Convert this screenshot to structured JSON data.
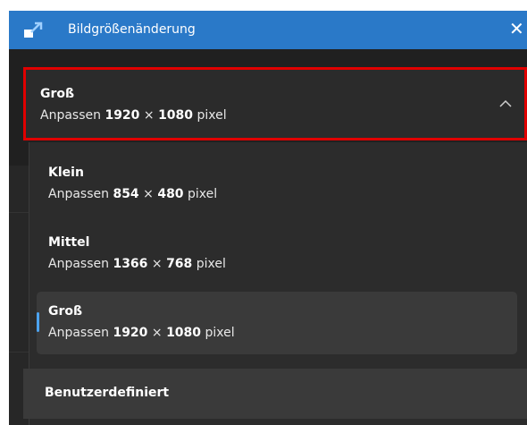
{
  "window": {
    "title": "Bildgrößenänderung",
    "close_glyph": "✕",
    "app_icon": "resize-app-icon",
    "accent_color": "#2a79c8"
  },
  "combo": {
    "label": "Groß",
    "prefix": "Anpassen",
    "width": "1920",
    "times": "×",
    "height": "1080",
    "unit": "pixel",
    "icon": "chevron-up-icon",
    "highlight_color": "#e00000"
  },
  "options": [
    {
      "label": "Klein",
      "prefix": "Anpassen",
      "width": "854",
      "times": "×",
      "height": "480",
      "unit": "pixel"
    },
    {
      "label": "Mittel",
      "prefix": "Anpassen",
      "width": "1366",
      "times": "×",
      "height": "768",
      "unit": "pixel"
    },
    {
      "label": "Groß",
      "prefix": "Anpassen",
      "width": "1920",
      "times": "×",
      "height": "1080",
      "unit": "pixel",
      "selected": true
    }
  ],
  "custom": {
    "label": "Benutzerdefiniert"
  }
}
